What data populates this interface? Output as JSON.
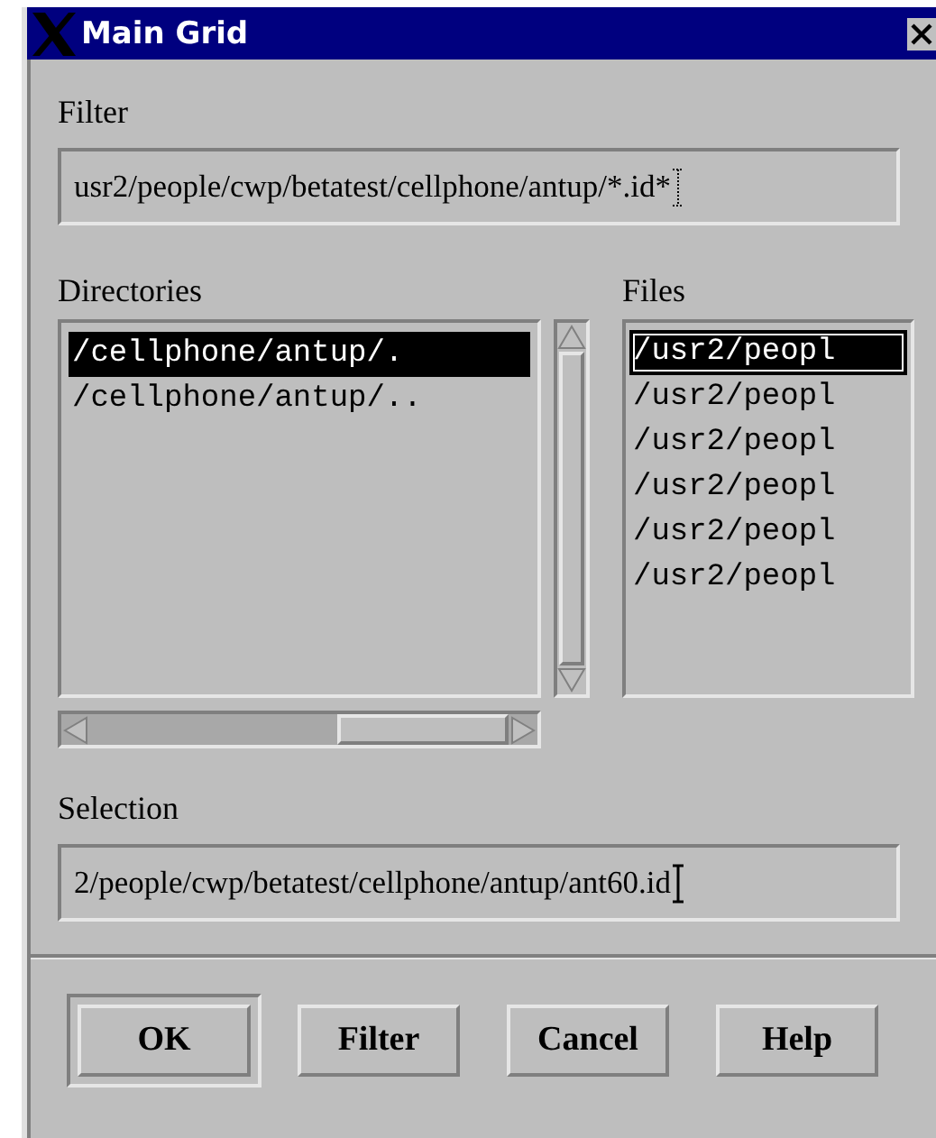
{
  "window": {
    "title": "Main Grid"
  },
  "filter": {
    "label": "Filter",
    "value": "usr2/people/cwp/betatest/cellphone/antup/*.id*"
  },
  "directories": {
    "label": "Directories",
    "items": [
      {
        "text": "/cellphone/antup/.",
        "selected": true
      },
      {
        "text": "/cellphone/antup/..",
        "selected": false
      }
    ]
  },
  "files": {
    "label": "Files",
    "items": [
      {
        "text": "/usr2/peopl",
        "selected": true
      },
      {
        "text": "/usr2/peopl",
        "selected": false
      },
      {
        "text": "/usr2/peopl",
        "selected": false
      },
      {
        "text": "/usr2/peopl",
        "selected": false
      },
      {
        "text": "/usr2/peopl",
        "selected": false
      },
      {
        "text": "/usr2/peopl",
        "selected": false
      }
    ]
  },
  "selection": {
    "label": "Selection",
    "value": "2/people/cwp/betatest/cellphone/antup/ant60.id"
  },
  "buttons": [
    {
      "label": "OK",
      "default": true
    },
    {
      "label": "Filter",
      "default": false
    },
    {
      "label": "Cancel",
      "default": false
    },
    {
      "label": "Help",
      "default": false
    }
  ]
}
